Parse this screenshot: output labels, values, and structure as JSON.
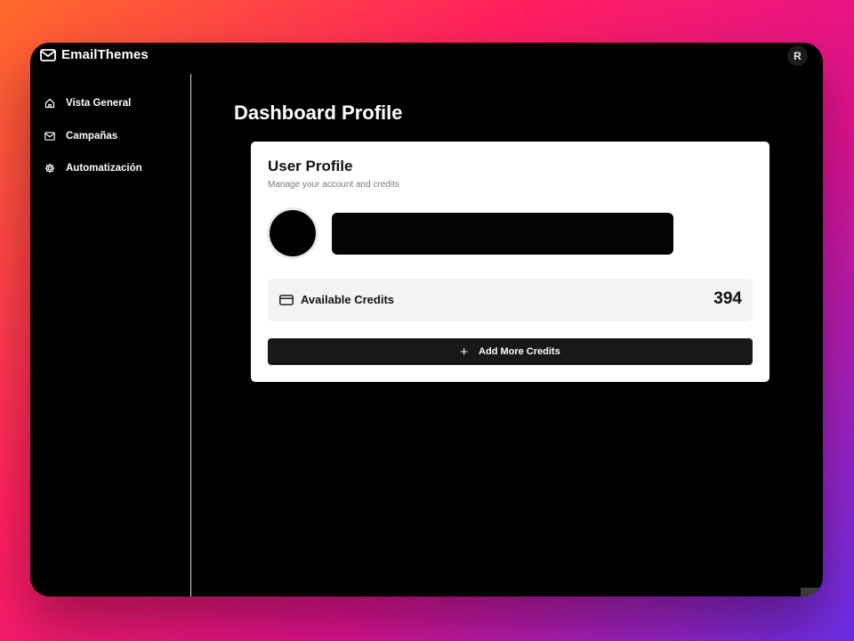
{
  "app": {
    "name": "EmailThemes",
    "user_initial": "R"
  },
  "sidebar": {
    "items": [
      {
        "label": "Vista General",
        "icon": "home-icon"
      },
      {
        "label": "Campañas",
        "icon": "mail-icon"
      },
      {
        "label": "Automatización",
        "icon": "gear-icon"
      }
    ]
  },
  "main": {
    "title": "Dashboard Profile"
  },
  "profile": {
    "title": "User Profile",
    "subtitle": "Manage your account and credits",
    "credits_label": "Available Credits",
    "credits_value": "394",
    "add_button_label": "Add More Credits",
    "add_button_icon": "plus-icon"
  },
  "colors": {
    "background_gradient": [
      "#ff6a2b",
      "#ff1f5e",
      "#e0128f",
      "#6a2ee8"
    ],
    "window": "#000000",
    "card": "#ffffff",
    "button": "#181818"
  }
}
